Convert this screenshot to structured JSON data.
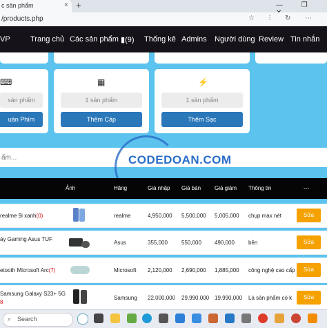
{
  "browser": {
    "tab_title": "c sản phẩm",
    "tab_close": "×",
    "new_tab": "+",
    "window_controls": "— ❐ ✕",
    "url": "/products.php",
    "addr_icons": "☆ ⫶ ↻ ⋯ ✦"
  },
  "nav": {
    "brand": "VP",
    "items": [
      "Trang chủ",
      "Các sản phẩm",
      "(9)",
      "Thống kê",
      "Admins",
      "Người dùng",
      "Review",
      "Tin nhắn"
    ]
  },
  "cards": [
    {
      "input": "sản phẩm",
      "button": "uàn Phím",
      "icon": "⌨"
    },
    {
      "input": "1 sản phẩm",
      "button": "Thêm Cáp",
      "icon": "▦"
    },
    {
      "input": "1 sản phẩm",
      "button": "Thêm Sạc",
      "icon": "⚡"
    }
  ],
  "search": {
    "placeholder": "ẩm..."
  },
  "watermark": "CODEDOAN.COM",
  "table": {
    "headers": [
      "Ảnh",
      "Hãng",
      "Giá nhập",
      "Giá bán",
      "Giá giảm",
      "Thông tin",
      "---"
    ],
    "rows": [
      {
        "name": "realme 9i xanh",
        "qty": "(0)",
        "brand": "realme",
        "import": "4,950,000",
        "price": "5,500,000",
        "sale": "5,005,000",
        "info": "chụp max nét",
        "action": "Sửa"
      },
      {
        "name": "áy Gaming Asus TUF",
        "qty": "",
        "brand": "Asus",
        "import": "355,000",
        "price": "550,000",
        "sale": "490,000",
        "info": "bền",
        "action": "Sửa"
      },
      {
        "name": "etooth Microsoft Arc",
        "qty": "(7)",
        "brand": "Microsoft",
        "import": "2,120,000",
        "price": "2,690,000",
        "sale": "1,885,000",
        "info": "công nghệ cao cấp",
        "action": "Sửa"
      },
      {
        "name": "Samsung Galaxy S23+ 5G",
        "qty": "8",
        "brand": "Samsung",
        "import": "22,000,000",
        "price": "29,990,000",
        "sale": "19,990,000",
        "info": "Là sản phẩm có k",
        "action": "Sửa"
      }
    ]
  },
  "taskbar": {
    "search_label": "Search"
  }
}
